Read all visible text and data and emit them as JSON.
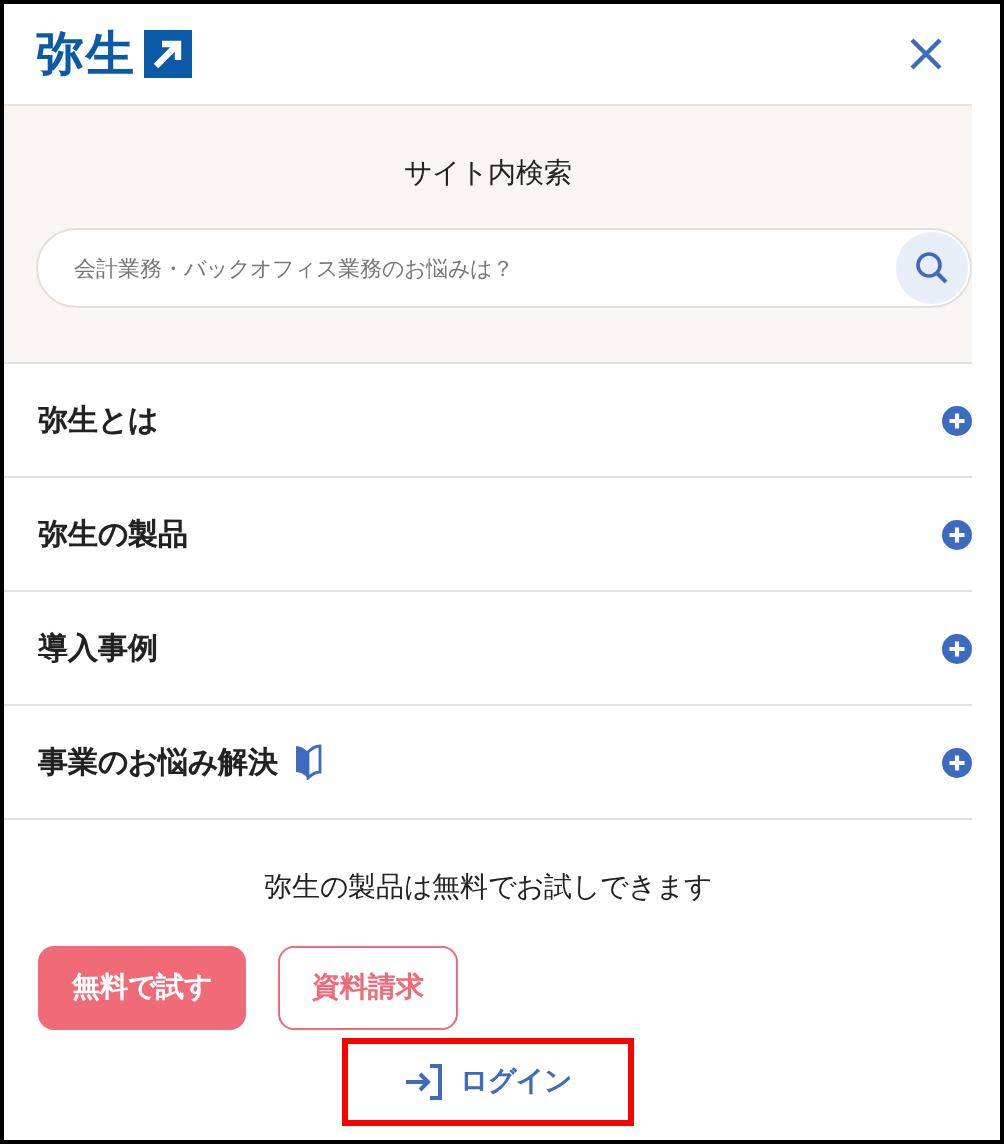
{
  "header": {
    "logo": "弥生"
  },
  "search": {
    "title": "サイト内検索",
    "placeholder": "会計業務・バックオフィス業務のお悩みは？"
  },
  "menu": [
    {
      "label": "弥生とは",
      "beginner_mark": false
    },
    {
      "label": "弥生の製品",
      "beginner_mark": false
    },
    {
      "label": "導入事例",
      "beginner_mark": false
    },
    {
      "label": "事業のお悩み解決",
      "beginner_mark": true
    }
  ],
  "trial": {
    "text": "弥生の製品は無料でお試しできます",
    "buttons": [
      {
        "label": "無料で試す",
        "kind": "filled"
      },
      {
        "label": "資料請求",
        "kind": "outline"
      }
    ]
  },
  "login": {
    "label": "ログイン",
    "highlighted": true
  }
}
